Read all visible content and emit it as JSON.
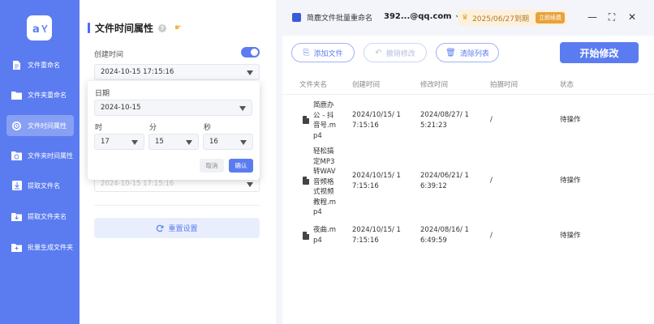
{
  "sidebar": {
    "logo_text": "a",
    "items": [
      {
        "label": "文件重命名",
        "icon": "document-icon"
      },
      {
        "label": "文件夹重命名",
        "icon": "folder-icon"
      },
      {
        "label": "文件时间属性",
        "icon": "clock-icon"
      },
      {
        "label": "文件夹时间属性",
        "icon": "folder-clock-icon"
      },
      {
        "label": "提取文件名",
        "icon": "extract-file-icon"
      },
      {
        "label": "提取文件夹名",
        "icon": "extract-folder-icon"
      },
      {
        "label": "批量生成文件夹",
        "icon": "folder-plus-icon"
      }
    ]
  },
  "settings": {
    "title": "文件时间属性",
    "created_label": "创建时间",
    "created_value": "2024-10-15 17:15:16",
    "faded_value": "2024-10-15 17:15:16",
    "reset_label": "重置设置"
  },
  "picker": {
    "date_label": "日期",
    "date_value": "2024-10-15",
    "hour_label": "时",
    "minute_label": "分",
    "second_label": "秒",
    "hour_value": "17",
    "minute_value": "15",
    "second_value": "16",
    "cancel_label": "取消",
    "ok_label": "确认"
  },
  "titlebar": {
    "app_name": "简鹿文件批量重命名",
    "account": "392...@qq.com",
    "vip_date": "2025/06/27到期",
    "vip_button": "立即续费",
    "minimize": "—",
    "maximize": "⛶",
    "close": "✕"
  },
  "toolbar": {
    "add_label": "添加文件",
    "undo_label": "撤销修改",
    "clear_label": "清除列表",
    "start_label": "开始修改"
  },
  "table": {
    "headers": [
      "文件夹名",
      "创建时间",
      "修改时间",
      "拍摄时间",
      "状态"
    ],
    "rows": [
      {
        "name": "简鹿办\n公 - 抖\n音号.m\np4",
        "created": "2024/10/15/ 1\n7:15:16",
        "modified": "2024/08/27/ 1\n5:21:23",
        "shot": "/",
        "status": "待操作"
      },
      {
        "name": "轻松搞\n定MP3\n转WAV\n音频格\n式视频\n教程.m\np4",
        "created": "2024/10/15/ 1\n7:15:16",
        "modified": "2024/06/21/ 1\n6:39:12",
        "shot": "/",
        "status": "待操作"
      },
      {
        "name": "夜曲.m\np4",
        "created": "2024/10/15/ 1\n7:15:16",
        "modified": "2024/08/16/ 1\n6:49:59",
        "shot": "/",
        "status": "待操作"
      }
    ]
  },
  "colors": {
    "accent": "#5b7cf0",
    "sidebar": "#5b7cf0",
    "vip": "#e8a23b"
  }
}
